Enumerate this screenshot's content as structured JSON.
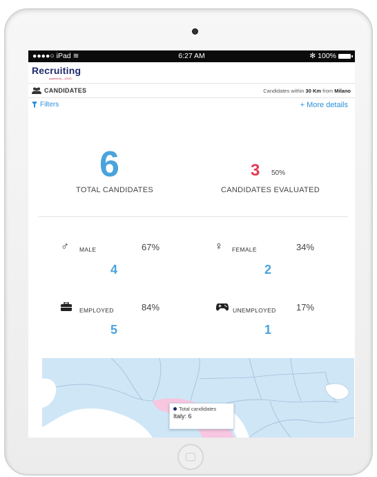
{
  "status_bar": {
    "carrier": "●●●●○ iPad",
    "time": "6:27 AM",
    "battery": "100%",
    "bluetooth": "✻"
  },
  "app": {
    "logo": "Recruiting",
    "logo_sub": "powered by ---LOGO"
  },
  "candidates_bar": {
    "title": "CANDIDATES",
    "subtitle_prefix": "Candidates within",
    "distance": "30 Km",
    "subtitle_mid": "from",
    "city": "Milano"
  },
  "filter_bar": {
    "filters_label": "Filters",
    "more_details_label": "More details"
  },
  "summary": {
    "total_value": "6",
    "total_label": "TOTAL CANDIDATES",
    "evaluated_value": "3",
    "evaluated_pct": "50%",
    "evaluated_label": "CANDIDATES EVALUATED"
  },
  "stats": {
    "male": {
      "label": "MALE",
      "pct": "67%",
      "value": "4"
    },
    "female": {
      "label": "FEMALE",
      "pct": "34%",
      "value": "2"
    },
    "employed": {
      "label": "EMPLOYED",
      "pct": "84%",
      "value": "5"
    },
    "unemployed": {
      "label": "UNEMPLOYED",
      "pct": "17%",
      "value": "1"
    }
  },
  "map": {
    "tooltip_series": "Total candidates",
    "tooltip_value": "Italy: 6",
    "highlight_color": "#f7c6e0",
    "land_color": "#cfe6f7"
  },
  "colors": {
    "accent_blue": "#4aa3db",
    "accent_red": "#e33b55",
    "link_blue": "#2b8fd9"
  }
}
